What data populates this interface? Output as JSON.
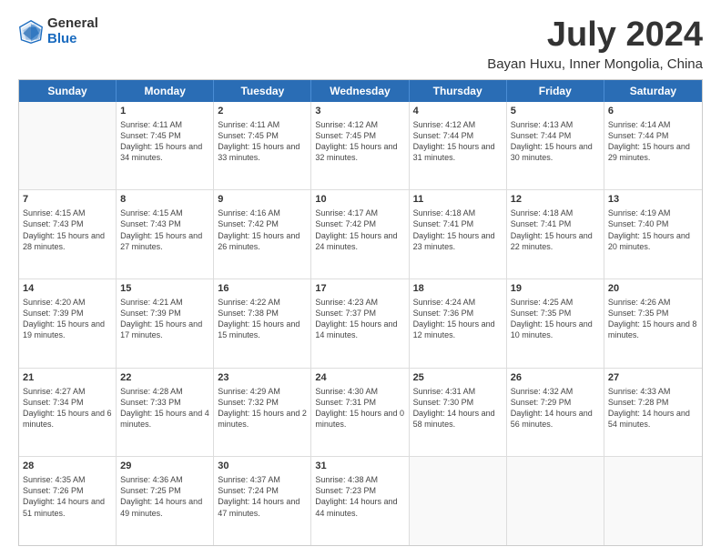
{
  "logo": {
    "general": "General",
    "blue": "Blue"
  },
  "title": "July 2024",
  "subtitle": "Bayan Huxu, Inner Mongolia, China",
  "header_days": [
    "Sunday",
    "Monday",
    "Tuesday",
    "Wednesday",
    "Thursday",
    "Friday",
    "Saturday"
  ],
  "weeks": [
    [
      {
        "day": "",
        "sunrise": "",
        "sunset": "",
        "daylight": ""
      },
      {
        "day": "1",
        "sunrise": "Sunrise: 4:11 AM",
        "sunset": "Sunset: 7:45 PM",
        "daylight": "Daylight: 15 hours and 34 minutes."
      },
      {
        "day": "2",
        "sunrise": "Sunrise: 4:11 AM",
        "sunset": "Sunset: 7:45 PM",
        "daylight": "Daylight: 15 hours and 33 minutes."
      },
      {
        "day": "3",
        "sunrise": "Sunrise: 4:12 AM",
        "sunset": "Sunset: 7:45 PM",
        "daylight": "Daylight: 15 hours and 32 minutes."
      },
      {
        "day": "4",
        "sunrise": "Sunrise: 4:12 AM",
        "sunset": "Sunset: 7:44 PM",
        "daylight": "Daylight: 15 hours and 31 minutes."
      },
      {
        "day": "5",
        "sunrise": "Sunrise: 4:13 AM",
        "sunset": "Sunset: 7:44 PM",
        "daylight": "Daylight: 15 hours and 30 minutes."
      },
      {
        "day": "6",
        "sunrise": "Sunrise: 4:14 AM",
        "sunset": "Sunset: 7:44 PM",
        "daylight": "Daylight: 15 hours and 29 minutes."
      }
    ],
    [
      {
        "day": "7",
        "sunrise": "Sunrise: 4:15 AM",
        "sunset": "Sunset: 7:43 PM",
        "daylight": "Daylight: 15 hours and 28 minutes."
      },
      {
        "day": "8",
        "sunrise": "Sunrise: 4:15 AM",
        "sunset": "Sunset: 7:43 PM",
        "daylight": "Daylight: 15 hours and 27 minutes."
      },
      {
        "day": "9",
        "sunrise": "Sunrise: 4:16 AM",
        "sunset": "Sunset: 7:42 PM",
        "daylight": "Daylight: 15 hours and 26 minutes."
      },
      {
        "day": "10",
        "sunrise": "Sunrise: 4:17 AM",
        "sunset": "Sunset: 7:42 PM",
        "daylight": "Daylight: 15 hours and 24 minutes."
      },
      {
        "day": "11",
        "sunrise": "Sunrise: 4:18 AM",
        "sunset": "Sunset: 7:41 PM",
        "daylight": "Daylight: 15 hours and 23 minutes."
      },
      {
        "day": "12",
        "sunrise": "Sunrise: 4:18 AM",
        "sunset": "Sunset: 7:41 PM",
        "daylight": "Daylight: 15 hours and 22 minutes."
      },
      {
        "day": "13",
        "sunrise": "Sunrise: 4:19 AM",
        "sunset": "Sunset: 7:40 PM",
        "daylight": "Daylight: 15 hours and 20 minutes."
      }
    ],
    [
      {
        "day": "14",
        "sunrise": "Sunrise: 4:20 AM",
        "sunset": "Sunset: 7:39 PM",
        "daylight": "Daylight: 15 hours and 19 minutes."
      },
      {
        "day": "15",
        "sunrise": "Sunrise: 4:21 AM",
        "sunset": "Sunset: 7:39 PM",
        "daylight": "Daylight: 15 hours and 17 minutes."
      },
      {
        "day": "16",
        "sunrise": "Sunrise: 4:22 AM",
        "sunset": "Sunset: 7:38 PM",
        "daylight": "Daylight: 15 hours and 15 minutes."
      },
      {
        "day": "17",
        "sunrise": "Sunrise: 4:23 AM",
        "sunset": "Sunset: 7:37 PM",
        "daylight": "Daylight: 15 hours and 14 minutes."
      },
      {
        "day": "18",
        "sunrise": "Sunrise: 4:24 AM",
        "sunset": "Sunset: 7:36 PM",
        "daylight": "Daylight: 15 hours and 12 minutes."
      },
      {
        "day": "19",
        "sunrise": "Sunrise: 4:25 AM",
        "sunset": "Sunset: 7:35 PM",
        "daylight": "Daylight: 15 hours and 10 minutes."
      },
      {
        "day": "20",
        "sunrise": "Sunrise: 4:26 AM",
        "sunset": "Sunset: 7:35 PM",
        "daylight": "Daylight: 15 hours and 8 minutes."
      }
    ],
    [
      {
        "day": "21",
        "sunrise": "Sunrise: 4:27 AM",
        "sunset": "Sunset: 7:34 PM",
        "daylight": "Daylight: 15 hours and 6 minutes."
      },
      {
        "day": "22",
        "sunrise": "Sunrise: 4:28 AM",
        "sunset": "Sunset: 7:33 PM",
        "daylight": "Daylight: 15 hours and 4 minutes."
      },
      {
        "day": "23",
        "sunrise": "Sunrise: 4:29 AM",
        "sunset": "Sunset: 7:32 PM",
        "daylight": "Daylight: 15 hours and 2 minutes."
      },
      {
        "day": "24",
        "sunrise": "Sunrise: 4:30 AM",
        "sunset": "Sunset: 7:31 PM",
        "daylight": "Daylight: 15 hours and 0 minutes."
      },
      {
        "day": "25",
        "sunrise": "Sunrise: 4:31 AM",
        "sunset": "Sunset: 7:30 PM",
        "daylight": "Daylight: 14 hours and 58 minutes."
      },
      {
        "day": "26",
        "sunrise": "Sunrise: 4:32 AM",
        "sunset": "Sunset: 7:29 PM",
        "daylight": "Daylight: 14 hours and 56 minutes."
      },
      {
        "day": "27",
        "sunrise": "Sunrise: 4:33 AM",
        "sunset": "Sunset: 7:28 PM",
        "daylight": "Daylight: 14 hours and 54 minutes."
      }
    ],
    [
      {
        "day": "28",
        "sunrise": "Sunrise: 4:35 AM",
        "sunset": "Sunset: 7:26 PM",
        "daylight": "Daylight: 14 hours and 51 minutes."
      },
      {
        "day": "29",
        "sunrise": "Sunrise: 4:36 AM",
        "sunset": "Sunset: 7:25 PM",
        "daylight": "Daylight: 14 hours and 49 minutes."
      },
      {
        "day": "30",
        "sunrise": "Sunrise: 4:37 AM",
        "sunset": "Sunset: 7:24 PM",
        "daylight": "Daylight: 14 hours and 47 minutes."
      },
      {
        "day": "31",
        "sunrise": "Sunrise: 4:38 AM",
        "sunset": "Sunset: 7:23 PM",
        "daylight": "Daylight: 14 hours and 44 minutes."
      },
      {
        "day": "",
        "sunrise": "",
        "sunset": "",
        "daylight": ""
      },
      {
        "day": "",
        "sunrise": "",
        "sunset": "",
        "daylight": ""
      },
      {
        "day": "",
        "sunrise": "",
        "sunset": "",
        "daylight": ""
      }
    ]
  ]
}
